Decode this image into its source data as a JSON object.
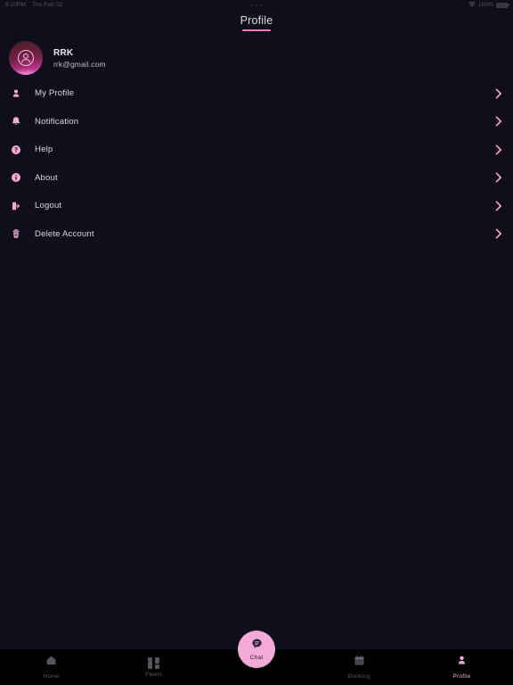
{
  "status_bar": {
    "time": "6:20PM",
    "date": "Thu Feb 22",
    "battery_percent": "100%",
    "wifi_icon": "wifi-icon",
    "battery_icon": "battery-full-icon"
  },
  "header": {
    "title": "Profile"
  },
  "profile": {
    "name": "RRK",
    "email": "rrk@gmail.com",
    "avatar_icon": "user-circle-avatar-icon"
  },
  "menu": {
    "items": [
      {
        "id": "my-profile",
        "label": "My Profile",
        "icon": "person-icon",
        "chevron": "chevron-right-icon"
      },
      {
        "id": "notification",
        "label": "Notification",
        "icon": "bell-icon",
        "chevron": "chevron-right-icon"
      },
      {
        "id": "help",
        "label": "Help",
        "icon": "question-circle-icon",
        "chevron": "chevron-right-icon"
      },
      {
        "id": "about",
        "label": "About",
        "icon": "info-circle-icon",
        "chevron": "chevron-right-icon"
      },
      {
        "id": "logout",
        "label": "Logout",
        "icon": "logout-icon",
        "chevron": "chevron-right-icon"
      },
      {
        "id": "delete-account",
        "label": "Delete Account",
        "icon": "trash-icon",
        "chevron": "chevron-right-icon"
      }
    ]
  },
  "bottom_nav": {
    "tabs": [
      {
        "id": "home",
        "label": "Home",
        "icon": "home-icon",
        "active": false
      },
      {
        "id": "fleets",
        "label": "Fleets",
        "icon": "grid-icon",
        "active": false
      },
      {
        "id": "booking",
        "label": "Booking",
        "icon": "calendar-icon",
        "active": false
      },
      {
        "id": "profile",
        "label": "Profile",
        "icon": "person-icon",
        "active": true
      }
    ],
    "fab": {
      "id": "chat",
      "label": "Chat",
      "icon": "chat-bubble-icon"
    }
  },
  "colors": {
    "background": "#110e1c",
    "nav_background": "#000000",
    "accent_pink": "#f3aad6",
    "accent_underline": "#f07db8",
    "inactive_gray": "#58555d",
    "text_primary": "#e9e6ef"
  }
}
